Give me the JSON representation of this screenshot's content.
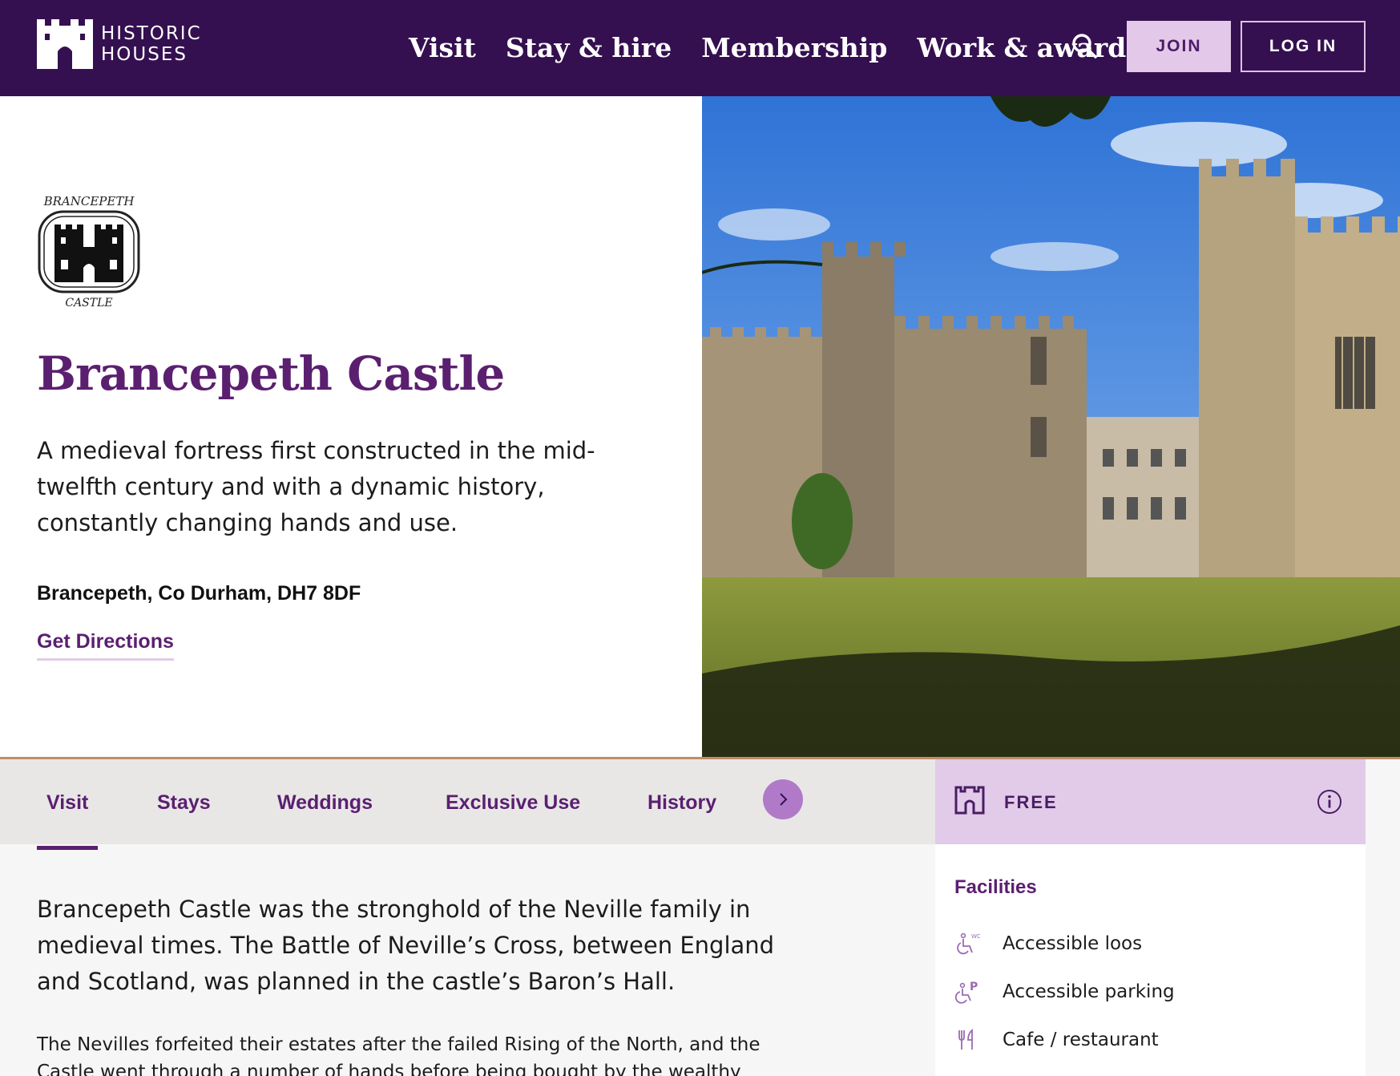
{
  "header": {
    "logo_line1": "HISTORIC",
    "logo_line2": "HOUSES",
    "nav": [
      "Visit",
      "Stay & hire",
      "Membership",
      "Work & awards"
    ],
    "join_label": "JOIN",
    "login_label": "LOG IN",
    "background": "#351050"
  },
  "hero": {
    "crest_top_text": "BRANCEPETH",
    "crest_bottom_text": "CASTLE",
    "title": "Brancepeth Castle",
    "intro": "A medieval fortress first constructed in the mid-twelfth century and with a dynamic history, constantly changing hands and use.",
    "address": "Brancepeth, Co Durham, DH7 8DF",
    "directions_label": "Get Directions"
  },
  "tabs": {
    "items": [
      "Visit",
      "Stays",
      "Weddings",
      "Exclusive Use",
      "History"
    ],
    "active": "Visit"
  },
  "admission": {
    "label": "FREE"
  },
  "content": {
    "lead": "Brancepeth Castle was the stronghold of the Neville family in medieval times. The Battle of Neville’s Cross, between England and Scotland, was planned in the castle’s Baron’s Hall.",
    "paragraph": "The Nevilles forfeited their estates after the failed Rising of the North, and the Castle went through a number of hands before being bought by the wealthy"
  },
  "facilities": {
    "title": "Facilities",
    "items": [
      "Accessible loos",
      "Accessible parking",
      "Cafe / restaurant"
    ]
  },
  "colors": {
    "brand_purple": "#5b1f70",
    "lilac": "#e2cbe8",
    "accent_copper": "#c08c66"
  }
}
